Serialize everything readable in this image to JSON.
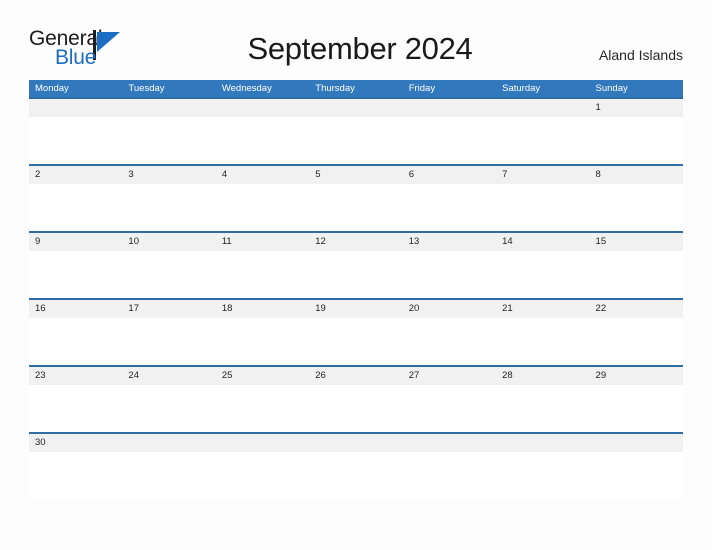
{
  "brand": {
    "name_part1": "General",
    "name_part2": "Blue",
    "flag_icon": "blue-flag-triangle-icon",
    "accent_color": "#1b6ec2"
  },
  "header": {
    "title": "September 2024",
    "region": "Aland Islands"
  },
  "calendar": {
    "month": "September",
    "year": "2024",
    "header_color": "#3178bd",
    "row_rule_color": "#2e6da4",
    "day_band_color": "#f1f1f1",
    "weekdays": [
      "Monday",
      "Tuesday",
      "Wednesday",
      "Thursday",
      "Friday",
      "Saturday",
      "Sunday"
    ],
    "weeks": [
      [
        "",
        "",
        "",
        "",
        "",
        "",
        "1"
      ],
      [
        "2",
        "3",
        "4",
        "5",
        "6",
        "7",
        "8"
      ],
      [
        "9",
        "10",
        "11",
        "12",
        "13",
        "14",
        "15"
      ],
      [
        "16",
        "17",
        "18",
        "19",
        "20",
        "21",
        "22"
      ],
      [
        "23",
        "24",
        "25",
        "26",
        "27",
        "28",
        "29"
      ],
      [
        "30",
        "",
        "",
        "",
        "",
        "",
        ""
      ]
    ]
  }
}
